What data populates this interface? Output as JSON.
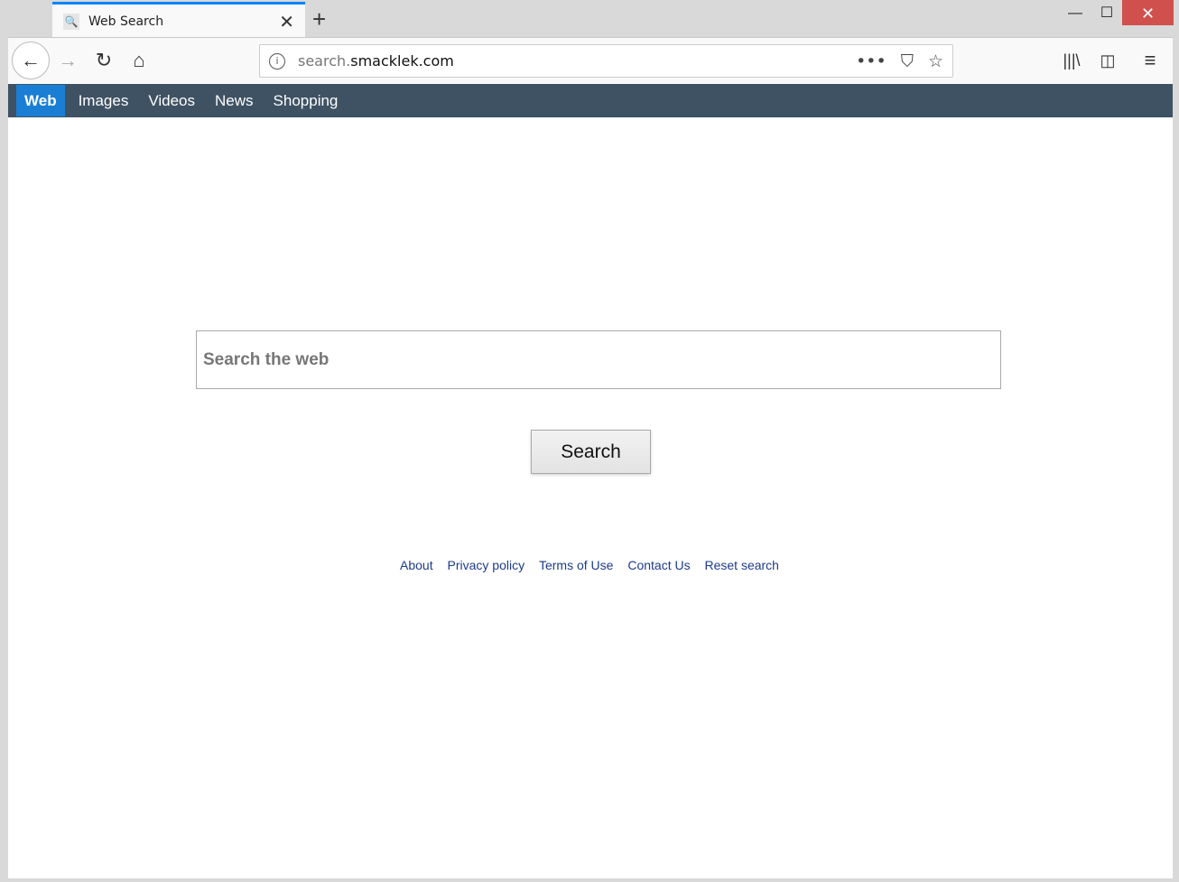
{
  "browser": {
    "tab_title": "Web Search",
    "url_prefix": "search.",
    "url_domain": "smacklek.com",
    "icons": [
      "search-icon",
      "close-icon",
      "plus-icon",
      "back-icon",
      "forward-icon",
      "reload-icon",
      "home-icon",
      "info-icon",
      "more-icon",
      "pocket-icon",
      "star-icon",
      "library-icon",
      "sidebar-icon",
      "menu-icon"
    ]
  },
  "nav": {
    "items": [
      "Web",
      "Images",
      "Videos",
      "News",
      "Shopping"
    ],
    "active": "Web",
    "active_color": "#1a7fd4",
    "bar_color": "#3e5263"
  },
  "search": {
    "placeholder": "Search the web",
    "button": "Search"
  },
  "footer": {
    "links": [
      "About",
      "Privacy policy",
      "Terms of Use",
      "Contact Us",
      "Reset search"
    ]
  }
}
